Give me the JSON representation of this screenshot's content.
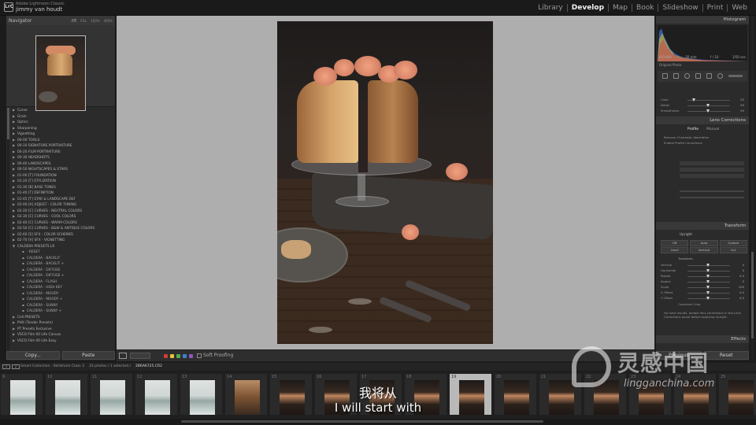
{
  "app": {
    "product": "Adobe Lightroom Classic",
    "user": "jimmy van houdt",
    "logo": "LrC",
    "modules": [
      "Library",
      "Develop",
      "Map",
      "Book",
      "Slideshow",
      "Print",
      "Web"
    ],
    "active_module": "Develop"
  },
  "left_panel": {
    "navigator_title": "Navigator",
    "zoom_options": [
      "FIT",
      "FILL",
      "100%",
      "400%"
    ],
    "presets": [
      {
        "label": "Curve",
        "indent": 0
      },
      {
        "label": "Grain",
        "indent": 0
      },
      {
        "label": "Optics",
        "indent": 0
      },
      {
        "label": "Sharpening",
        "indent": 0
      },
      {
        "label": "Vignetting",
        "indent": 0
      },
      {
        "label": "00-00 TOOLS",
        "indent": 0
      },
      {
        "label": "00-10 SIGNATURE PORTRAITURE",
        "indent": 0
      },
      {
        "label": "00-20 FILM PORTRAITURE",
        "indent": 0
      },
      {
        "label": "00-30 HEADSHOTS",
        "indent": 0
      },
      {
        "label": "00-40 LANDSCAPES",
        "indent": 0
      },
      {
        "label": "00-50 NIGHTSCAPES & STARS",
        "indent": 0
      },
      {
        "label": "01-00 [T] FOUNDATION",
        "indent": 0
      },
      {
        "label": "01-20 [T] STYLIZATION",
        "indent": 0
      },
      {
        "label": "01-30 [B] BASE TONES",
        "indent": 0
      },
      {
        "label": "01-40 [T] DEFINITION",
        "indent": 0
      },
      {
        "label": "01-45 [T] STAR & LANDSCAPE DEF",
        "indent": 0
      },
      {
        "label": "02-00 [A] ADJUST - COLOR TONING",
        "indent": 0
      },
      {
        "label": "02-20 [C] CURVES - NEUTRAL COLORS",
        "indent": 0
      },
      {
        "label": "02-30 [C] CURVES - COOL COLORS",
        "indent": 0
      },
      {
        "label": "02-40 [C] CURVES - WARM COLORS",
        "indent": 0
      },
      {
        "label": "02-50 [C] CURVES - B&W & ANTIQUE COLORS",
        "indent": 0
      },
      {
        "label": "02-60 [S] SFX - COLOR SCHEMES",
        "indent": 0
      },
      {
        "label": "02-70 [V] SFX - VIGNETTING",
        "indent": 0
      },
      {
        "label": "CALDERA PRESETS LR",
        "indent": 0,
        "open": true
      },
      {
        "label": "- RESET",
        "indent": 1
      },
      {
        "label": "CALDERA - BACKLIT",
        "indent": 1
      },
      {
        "label": "CALDERA - BACKLIT +",
        "indent": 1
      },
      {
        "label": "CALDERA - DIFFUSE",
        "indent": 1
      },
      {
        "label": "CALDERA - DIFFUSE +",
        "indent": 1
      },
      {
        "label": "CALDERA - FLASH",
        "indent": 1
      },
      {
        "label": "CALDERA - HIGH KEY",
        "indent": 1
      },
      {
        "label": "CALDERA - MOODY",
        "indent": 1
      },
      {
        "label": "CALDERA - MOODY +",
        "indent": 1
      },
      {
        "label": "CALDERA - SUNNY",
        "indent": 1
      },
      {
        "label": "CALDERA - SUNNY +",
        "indent": 1
      },
      {
        "label": "Cell PRESETS",
        "indent": 0
      },
      {
        "label": "PHX (Tender Presets)",
        "indent": 0
      },
      {
        "label": "PT Presets Exclusive",
        "indent": 0
      },
      {
        "label": "VSCO Film 00 Life Canvas",
        "indent": 0
      },
      {
        "label": "VSCO Film 00 Life Easy",
        "indent": 0
      }
    ],
    "copy_label": "Copy...",
    "paste_label": "Paste"
  },
  "toolbar": {
    "soft_proofing_label": "Soft Proofing",
    "color_labels": [
      "#d23c3c",
      "#e6c43a",
      "#4fae4f",
      "#3f7fd3",
      "#8e55c4"
    ]
  },
  "right_panel": {
    "histogram_title": "Histogram",
    "histogram_info": [
      "ISO 800",
      "50 mm",
      "f / 10",
      "1/50 sec"
    ],
    "original_photo_label": "Original Photo",
    "detail_sliders": [
      {
        "label": "Color",
        "value": "25"
      },
      {
        "label": "Detail",
        "value": "50"
      },
      {
        "label": "Smoothness",
        "value": "50"
      }
    ],
    "lens_corrections_title": "Lens Corrections",
    "lens_tabs": [
      "Profile",
      "Manual"
    ],
    "lens_options": [
      "Remove Chromatic Aberration",
      "Enable Profile Corrections"
    ],
    "transform_title": "Transform",
    "upright_label": "Upright",
    "upright_buttons_1": [
      "Off",
      "Auto",
      "Guided"
    ],
    "upright_buttons_2": [
      "Level",
      "Vertical",
      "Full"
    ],
    "transform_section_label": "Transform",
    "transform_sliders": [
      {
        "label": "Vertical",
        "value": "0"
      },
      {
        "label": "Horizontal",
        "value": "0"
      },
      {
        "label": "Rotate",
        "value": "0.0"
      },
      {
        "label": "Aspect",
        "value": "0"
      },
      {
        "label": "Scale",
        "value": "100"
      },
      {
        "label": "X Offset",
        "value": "0.0"
      },
      {
        "label": "Y Offset",
        "value": "0.0"
      }
    ],
    "constrain_crop_label": "Constrain Crop",
    "transform_note": "For best results, enable lens corrections in the Lens Corrections panel before applying Upright.",
    "effects_title": "Effects",
    "previous_label": "Previous",
    "reset_label": "Reset"
  },
  "filmstrip": {
    "breadcrumb_source": "Smart Collection : Skillshare Class 3",
    "count_text": "33 photos / 1 selected /",
    "filename": "2B6A6725.CR2",
    "monitors": [
      "1",
      "2"
    ],
    "frames": [
      {
        "num": "9",
        "tone": "light"
      },
      {
        "num": "10",
        "tone": "light"
      },
      {
        "num": "11",
        "tone": "light"
      },
      {
        "num": "12",
        "tone": "light"
      },
      {
        "num": "13",
        "tone": "light"
      },
      {
        "num": "14",
        "tone": "mid"
      },
      {
        "num": "15",
        "tone": "dark"
      },
      {
        "num": "16",
        "tone": "dark"
      },
      {
        "num": "17",
        "tone": "dark"
      },
      {
        "num": "18",
        "tone": "dark"
      },
      {
        "num": "19",
        "tone": "dark",
        "selected": true
      },
      {
        "num": "20",
        "tone": "dark"
      },
      {
        "num": "21",
        "tone": "dark"
      },
      {
        "num": "22",
        "tone": "dark"
      },
      {
        "num": "23",
        "tone": "dark"
      },
      {
        "num": "24",
        "tone": "dark"
      },
      {
        "num": "25",
        "tone": "dark"
      }
    ]
  },
  "overlay": {
    "subtitle_cn": "我将从",
    "subtitle_en": "I will start with",
    "watermark_cn": "灵感中国",
    "watermark_url": "lingganchina.com"
  }
}
